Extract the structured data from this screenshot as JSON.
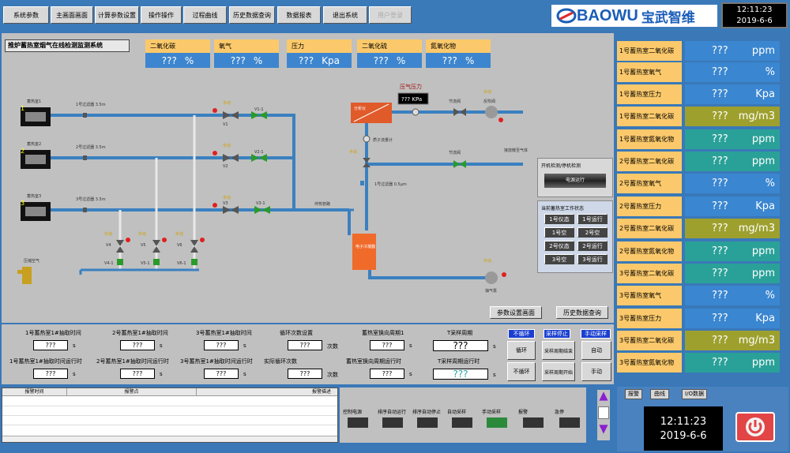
{
  "nav": [
    "系统参数",
    "主画面画面",
    "计算参数设置",
    "操作操作",
    "过程曲线",
    "历史数据查询",
    "数据报表",
    "退出系统",
    "用户登录"
  ],
  "brand": {
    "latin": "BAOWU",
    "cn": "宝武智维"
  },
  "clock": {
    "time": "12:11:23",
    "date": "2019-6-6"
  },
  "system_title": "推炉蓄热室烟气在线检测监测系统",
  "gas_boxes": [
    {
      "label": "二氧化碳",
      "value": "???",
      "unit": "%"
    },
    {
      "label": "氧气",
      "value": "???",
      "unit": "%"
    },
    {
      "label": "压力",
      "value": "???",
      "unit": "Kpa"
    },
    {
      "label": "二氧化硫",
      "value": "???",
      "unit": "%"
    },
    {
      "label": "氮氧化物",
      "value": "???",
      "unit": "%"
    }
  ],
  "right_panel": [
    {
      "label": "1号蓄热室二氧化碳",
      "value": "???",
      "unit": "ppm",
      "color": "#3a86d0"
    },
    {
      "label": "1号蓄热室氧气",
      "value": "???",
      "unit": "%",
      "color": "#3a86d0"
    },
    {
      "label": "1号蓄热室压力",
      "value": "???",
      "unit": "Kpa",
      "color": "#3a86d0"
    },
    {
      "label": "1号蓄热室二氧化碳",
      "value": "???",
      "unit": "mg/m3",
      "color": "#9ea02e"
    },
    {
      "label": "1号蓄热室氮氧化物",
      "value": "???",
      "unit": "ppm",
      "color": "#2aa198"
    },
    {
      "label": "2号蓄热室二氧化碳",
      "value": "???",
      "unit": "ppm",
      "color": "#2aa198"
    },
    {
      "label": "2号蓄热室氧气",
      "value": "???",
      "unit": "%",
      "color": "#3a86d0"
    },
    {
      "label": "2号蓄热室压力",
      "value": "???",
      "unit": "Kpa",
      "color": "#3a86d0"
    },
    {
      "label": "2号蓄热室二氧化碳",
      "value": "???",
      "unit": "mg/m3",
      "color": "#9ea02e"
    },
    {
      "label": "2号蓄热室氮氧化物",
      "value": "???",
      "unit": "ppm",
      "color": "#2aa198"
    },
    {
      "label": "3号蓄热室二氧化碳",
      "value": "???",
      "unit": "ppm",
      "color": "#2aa198"
    },
    {
      "label": "3号蓄热室氧气",
      "value": "???",
      "unit": "%",
      "color": "#3a86d0"
    },
    {
      "label": "3号蓄热室压力",
      "value": "???",
      "unit": "Kpa",
      "color": "#3a86d0"
    },
    {
      "label": "3号蓄热室二氧化碳",
      "value": "???",
      "unit": "mg/m3",
      "color": "#9ea02e"
    },
    {
      "label": "3号蓄热室氮氧化物",
      "value": "???",
      "unit": "ppm",
      "color": "#2aa198"
    }
  ],
  "diagram": {
    "chambers": [
      "蓄热室1",
      "蓄热室2",
      "蓄热室3"
    ],
    "chamber_nums": [
      "1",
      "2",
      "3"
    ],
    "filters": [
      "1号过滤器 3.5m",
      "2号过滤器 3.5m",
      "3号过滤器 3.5m"
    ],
    "manual": "手动",
    "valves": {
      "v1": "V1",
      "v11": "V1-1",
      "v2": "V2",
      "v21": "V2-1",
      "v3": "V3",
      "v31": "V3-1",
      "v4": "V4",
      "v41": "V4-1",
      "v5": "V5",
      "v51": "V5-1",
      "v6": "V6",
      "v61": "V6-1"
    },
    "air_tank": "压缩空气",
    "analyzer": "分析仪",
    "gas_pressure_label": "压气压力",
    "gas_pressure_value": "??? KPa",
    "flowmeter": "质子流量计",
    "filter2": "1号过滤器 0.5μm",
    "cooler": "冷凝器",
    "cooler_sub": "伴热管路",
    "pump": "电子冷凝器",
    "pump_label": "抽气泵",
    "pipe_labels": [
      "节流阀",
      "节流阀",
      "反吹阀",
      "接放散至气体"
    ],
    "note1": "伴热管路",
    "note2": "伴热管路"
  },
  "status_panel": {
    "title": "开机检测/停机检测",
    "btn": "电源运行",
    "work_title": "当前蓄热室工作状态",
    "works": [
      "1号仪态",
      "1号运行",
      "1号空",
      "2号空",
      "2号仪态",
      "2号运行",
      "3号空",
      "3号运行"
    ]
  },
  "links": {
    "params": "参数设置画面",
    "history": "历史数据查询"
  },
  "controls": {
    "rows": [
      [
        {
          "label": "1号蓄热室1#抽取时间",
          "val": "???",
          "unit": "s"
        },
        {
          "label": "2号蓄热室1#抽取时间",
          "val": "???",
          "unit": "s"
        },
        {
          "label": "3号蓄热室1#抽取时间",
          "val": "???",
          "unit": "s"
        },
        {
          "label": "循环次数设置",
          "val": "???",
          "unit": "次数"
        },
        {
          "label": "蓄热室换向周期1",
          "val": "???",
          "unit": "s"
        }
      ],
      [
        {
          "label": "1号蓄热室1#抽取时间运行时",
          "val": "???",
          "unit": "s"
        },
        {
          "label": "2号蓄热室1#抽取时间运行时",
          "val": "???",
          "unit": "s"
        },
        {
          "label": "3号蓄热室1#抽取时间运行时",
          "val": "???",
          "unit": "s"
        },
        {
          "label": "实际循环次数",
          "val": "???",
          "unit": "次数"
        },
        {
          "label": "蓄热室换向周期运行时",
          "val": "???",
          "unit": "s"
        }
      ]
    ],
    "sample_period": {
      "label": "T采样周期",
      "val": "???",
      "unit": "s"
    },
    "sample_run": {
      "label": "T采样周期运行时",
      "val": "???",
      "unit": "s"
    },
    "tags": [
      "不循环",
      "采样停止",
      "手动采样"
    ],
    "btns": [
      "循环",
      "采样周期结束",
      "自动",
      "不循环",
      "采样周期开始",
      "手动"
    ]
  },
  "log": {
    "headers": [
      "报警时间",
      "报警点",
      "报警描述"
    ]
  },
  "status_lamps": [
    "控制电源",
    "排序自动运行",
    "排序自动停止",
    "自动采样",
    "手动采样",
    "报警",
    "急停"
  ],
  "br": {
    "buttons": [
      "报警",
      "曲线",
      "I/O数据"
    ]
  }
}
